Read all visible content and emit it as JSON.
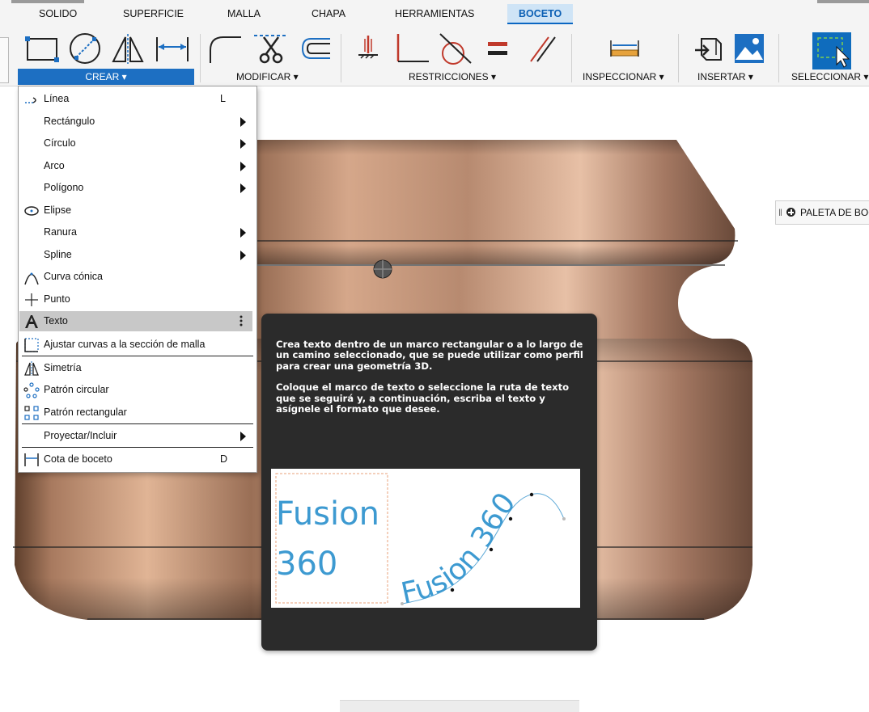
{
  "ribbon": {
    "tabs": [
      {
        "label": "SOLIDO"
      },
      {
        "label": "SUPERFICIE"
      },
      {
        "label": "MALLA"
      },
      {
        "label": "CHAPA"
      },
      {
        "label": "HERRAMIENTAS"
      },
      {
        "label": "BOCETO",
        "active": true
      }
    ],
    "groups": {
      "crear": "CREAR ▾",
      "modificar": "MODIFICAR ▾",
      "restricciones": "RESTRICCIONES ▾",
      "inspeccionar": "INSPECCIONAR ▾",
      "insertar": "INSERTAR ▾",
      "seleccionar": "SELECCIONAR ▾"
    }
  },
  "palette": {
    "label": "PALETA DE BOCETO"
  },
  "menu": {
    "items": [
      {
        "label": "Línea",
        "shortcut": "L",
        "icon": "line-icon"
      },
      {
        "label": "Rectángulo",
        "submenu": true
      },
      {
        "label": "Círculo",
        "submenu": true
      },
      {
        "label": "Arco",
        "submenu": true
      },
      {
        "label": "Polígono",
        "submenu": true
      },
      {
        "label": "Elipse",
        "icon": "ellipse-icon"
      },
      {
        "label": "Ranura",
        "submenu": true
      },
      {
        "label": "Spline",
        "submenu": true
      },
      {
        "label": "Curva cónica",
        "icon": "conic-curve-icon"
      },
      {
        "label": "Punto",
        "icon": "point-icon"
      },
      {
        "label": "Texto",
        "icon": "text-icon",
        "highlighted": true
      },
      {
        "label": "Ajustar curvas a la sección de malla",
        "icon": "fit-curves-icon"
      },
      {
        "label": "Simetría",
        "icon": "mirror-icon"
      },
      {
        "label": "Patrón circular",
        "icon": "circular-pattern-icon"
      },
      {
        "label": "Patrón rectangular",
        "icon": "rectangular-pattern-icon"
      },
      {
        "label": "Proyectar/Incluir",
        "submenu": true
      },
      {
        "label": "Cota de boceto",
        "shortcut": "D",
        "icon": "sketch-dimension-icon"
      }
    ]
  },
  "tooltip": {
    "paragraph1": "Crea texto dentro de un marco rectangular o a lo largo de un camino seleccionado, que se puede utilizar como perfil para crear una geometría 3D.",
    "paragraph2": "Coloque el marco de texto o seleccione la ruta de texto que se seguirá y, a continuación, escriba el texto y asígnele el formato que desee.",
    "illustration": {
      "box_line1": "Fusion",
      "box_line2": "360",
      "path_text_part1": "Fusion",
      "path_text_part2": "360"
    }
  },
  "colors": {
    "accent": "#1d6fc2",
    "active_tab_bg": "#cfe4f6",
    "tooltip_bg": "#2b2b2b",
    "text_sample": "#3d9ad1",
    "copper": "#b8866a"
  }
}
